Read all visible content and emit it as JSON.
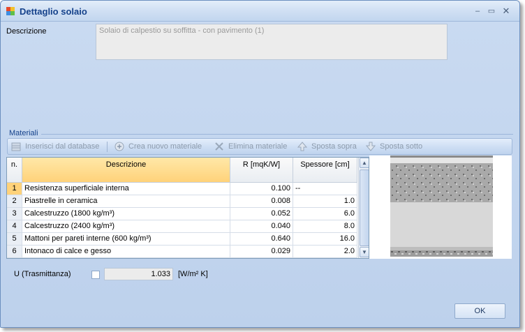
{
  "window": {
    "title": "Dettaglio solaio",
    "min": "–",
    "max": "▭",
    "close": "✕"
  },
  "descrizione": {
    "label": "Descrizione",
    "value": "Solaio di calpestio su soffitta - con pavimento (1)"
  },
  "materiali": {
    "title": "Materiali",
    "toolbar": {
      "insert": "Inserisci dal database",
      "create": "Crea nuovo materiale",
      "delete": "Elimina materiale",
      "up": "Sposta sopra",
      "down": "Sposta sotto"
    },
    "columns": {
      "n": "n.",
      "descrizione": "Descrizione",
      "r": "R [mqK/W]",
      "spessore": "Spessore [cm]"
    },
    "rows": [
      {
        "n": "1",
        "descrizione": "Resistenza superficiale interna",
        "r": "0.100",
        "spessore": "--"
      },
      {
        "n": "2",
        "descrizione": "Piastrelle in ceramica",
        "r": "0.008",
        "spessore": "1.0"
      },
      {
        "n": "3",
        "descrizione": "Calcestruzzo (1800 kg/m³)",
        "r": "0.052",
        "spessore": "6.0"
      },
      {
        "n": "4",
        "descrizione": "Calcestruzzo (2400 kg/m³)",
        "r": "0.040",
        "spessore": "8.0"
      },
      {
        "n": "5",
        "descrizione": "Mattoni per pareti interne (600 kg/m³)",
        "r": "0.640",
        "spessore": "16.0"
      },
      {
        "n": "6",
        "descrizione": "Intonaco di calce e gesso",
        "r": "0.029",
        "spessore": "2.0"
      }
    ]
  },
  "trasmittanza": {
    "label": "U (Trasmittanza)",
    "value": "1.033",
    "unit": "[W/m² K]"
  },
  "ok": "OK",
  "colors": {
    "accent": "#15428b",
    "selected_header": "#ffd27a",
    "background": "#bdd1ec"
  }
}
